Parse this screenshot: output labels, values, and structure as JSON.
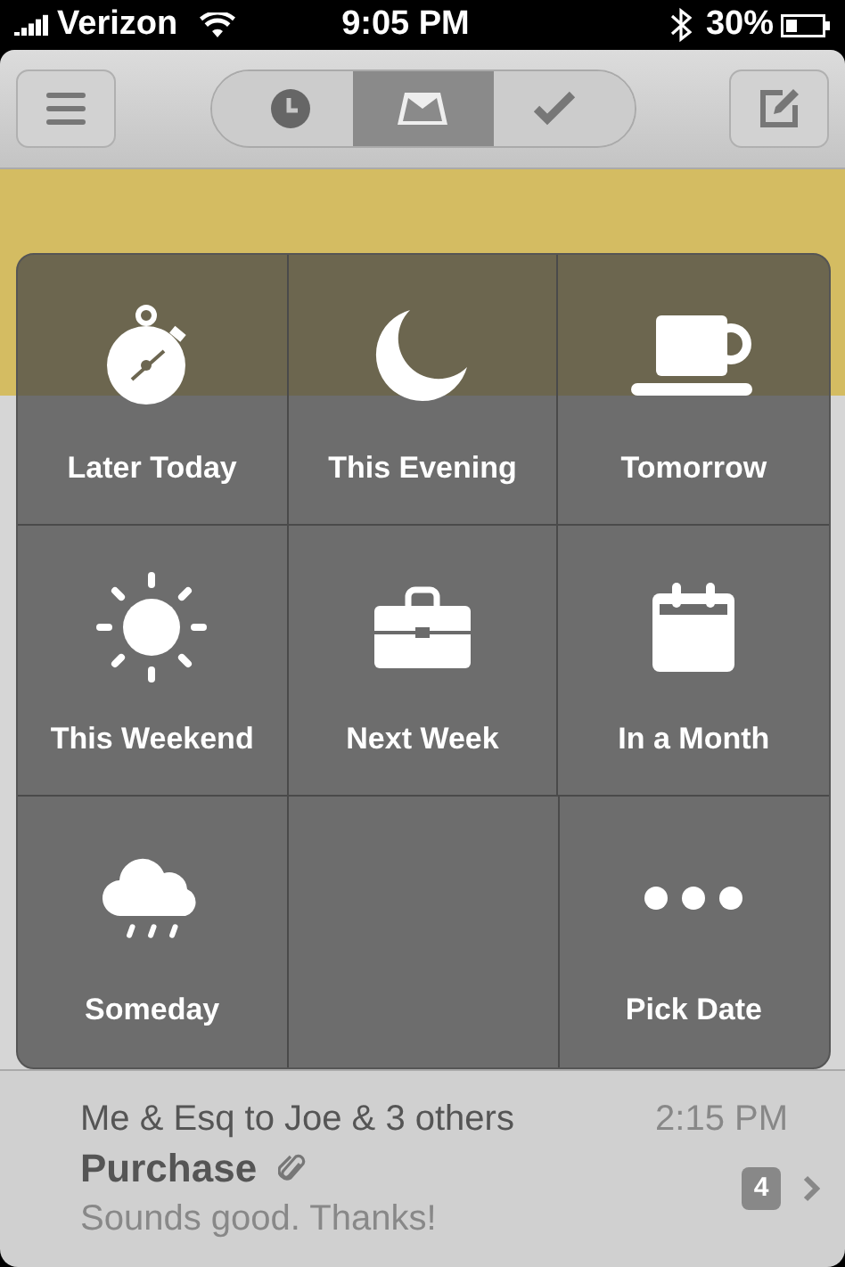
{
  "status_bar": {
    "carrier": "Verizon",
    "time": "9:05 PM",
    "battery": "30%"
  },
  "nav": {
    "tabs": [
      {
        "kind": "later",
        "selected": false
      },
      {
        "kind": "inbox",
        "selected": true
      },
      {
        "kind": "done",
        "selected": false
      }
    ]
  },
  "snooze_options": [
    {
      "kind": "later-today",
      "label": "Later Today"
    },
    {
      "kind": "this-evening",
      "label": "This Evening"
    },
    {
      "kind": "tomorrow",
      "label": "Tomorrow"
    },
    {
      "kind": "this-weekend",
      "label": "This Weekend"
    },
    {
      "kind": "next-week",
      "label": "Next Week"
    },
    {
      "kind": "in-a-month",
      "label": "In a Month"
    },
    {
      "kind": "someday",
      "label": "Someday"
    },
    {
      "kind": "pick-date",
      "label": "Pick Date"
    }
  ],
  "emails": [
    {
      "sender": "Me & Esq to Joe & 3 others",
      "time": "2:15 PM",
      "subject": "Purchase",
      "attachment": true,
      "preview": "Sounds good. Thanks!",
      "count": "4"
    }
  ]
}
